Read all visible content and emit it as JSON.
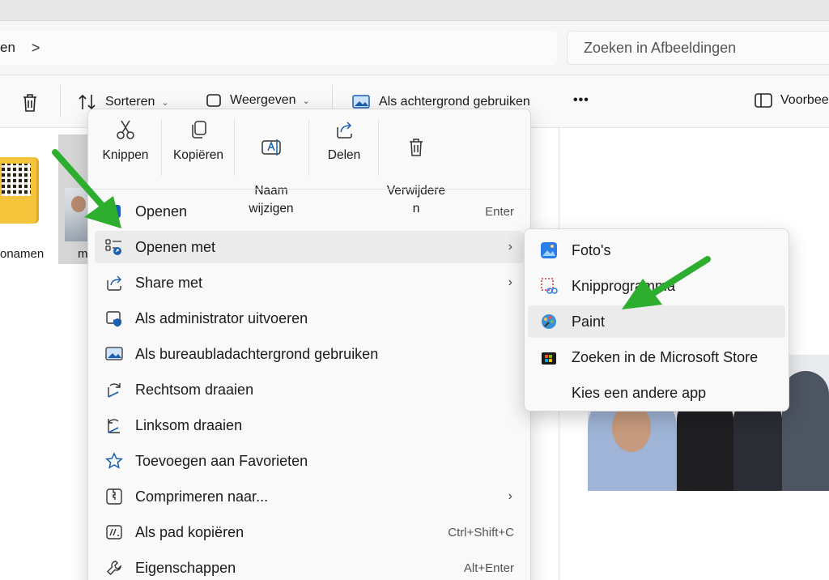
{
  "address": {
    "crumb": "en",
    "separator": ">"
  },
  "search": {
    "placeholder": "Zoeken in Afbeeldingen"
  },
  "toolbar": {
    "sort_label": "Sorteren",
    "view_label": "Weergeven",
    "background_label": "Als achtergrond gebruiken",
    "more_label": "•••",
    "preview_label": "Voorbee"
  },
  "files": {
    "folder_label": "onamen",
    "image_label": "m"
  },
  "context_menu": {
    "actions": [
      {
        "label": "Knippen",
        "icon": "cut-icon"
      },
      {
        "label": "Kopiëren",
        "icon": "copy-icon"
      },
      {
        "label": "Naam\nwijzigen",
        "icon": "rename-icon"
      },
      {
        "label": "Delen",
        "icon": "share-icon"
      },
      {
        "label": "Verwijdere\nn",
        "icon": "trash-icon"
      }
    ],
    "items": [
      {
        "label": "Openen",
        "shortcut": "Enter"
      },
      {
        "label": "Openen met",
        "has_submenu": true
      },
      {
        "label": "Share met",
        "has_submenu": true
      },
      {
        "label": "Als administrator uitvoeren"
      },
      {
        "label": "Als bureaubladachtergrond gebruiken"
      },
      {
        "label": "Rechtsom draaien"
      },
      {
        "label": "Linksom draaien"
      },
      {
        "label": "Toevoegen aan Favorieten"
      },
      {
        "label": "Comprimeren naar...",
        "has_submenu": true
      },
      {
        "label": "Als pad kopiëren",
        "shortcut": "Ctrl+Shift+C"
      },
      {
        "label": "Eigenschappen",
        "shortcut": "Alt+Enter"
      }
    ]
  },
  "open_with_submenu": {
    "items": [
      {
        "label": "Foto's"
      },
      {
        "label": "Knipprogramma"
      },
      {
        "label": "Paint"
      },
      {
        "label": "Zoeken in de Microsoft Store"
      },
      {
        "label": "Kies een andere app"
      }
    ]
  },
  "colors": {
    "accent": "#0067c0",
    "annotation_arrow": "#2eae2e",
    "highlight": "#ebebeb"
  }
}
